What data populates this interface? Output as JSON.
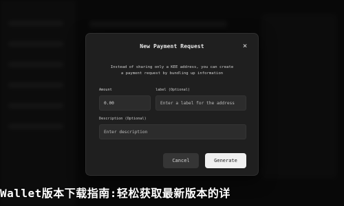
{
  "modal": {
    "title": "New Payment Request",
    "close_glyph": "×",
    "description_line1": "Instead of sharing only a KEE address, you can create",
    "description_line2": "a payment request by bundling up information",
    "amount_label": "Amount",
    "amount_value": "0.00",
    "label_field_label": "label (Optional)",
    "label_field_placeholder": "Enter a label for the address",
    "description_field_label": "Description (Optional)",
    "description_field_placeholder": "Enter description",
    "cancel_label": "Cancel",
    "generate_label": "Generate"
  },
  "headline": "Wallet版本下载指南:轻松获取最新版本的详",
  "icons": {
    "close": "close-icon"
  },
  "colors": {
    "modal_bg": "#1f1f1f",
    "primary_button": "#f0f0f0",
    "secondary_button": "#353535"
  }
}
